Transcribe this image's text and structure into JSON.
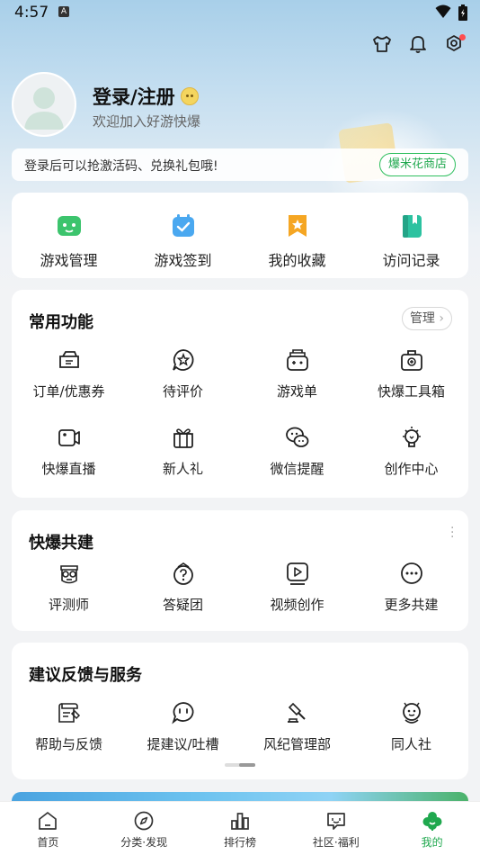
{
  "status_bar": {
    "time": "4:57",
    "notif_letter": "A"
  },
  "profile": {
    "title": "登录/注册",
    "subtitle": "欢迎加入好游快爆"
  },
  "notice": {
    "text": "登录后可以抢激活码、兑换礼包哦!",
    "button": "爆米花商店"
  },
  "quick": [
    {
      "label": "游戏管理",
      "color": "#3cc46d",
      "icon": "gamepad-icon"
    },
    {
      "label": "游戏签到",
      "color": "#4aa8f0",
      "icon": "calendar-check-icon"
    },
    {
      "label": "我的收藏",
      "color": "#f5a623",
      "icon": "bookmark-star-icon"
    },
    {
      "label": "访问记录",
      "color": "#2cc2a0",
      "icon": "book-icon"
    }
  ],
  "common": {
    "title": "常用功能",
    "manage": "管理",
    "items": [
      {
        "label": "订单/优惠券",
        "icon": "coupon-icon"
      },
      {
        "label": "待评价",
        "icon": "star-bubble-icon"
      },
      {
        "label": "游戏单",
        "icon": "game-list-icon"
      },
      {
        "label": "快爆工具箱",
        "icon": "toolbox-icon"
      },
      {
        "label": "快爆直播",
        "icon": "video-camera-icon"
      },
      {
        "label": "新人礼",
        "icon": "gift-icon"
      },
      {
        "label": "微信提醒",
        "icon": "wechat-icon"
      },
      {
        "label": "创作中心",
        "icon": "lightbulb-icon"
      }
    ]
  },
  "build": {
    "title": "快爆共建",
    "items": [
      {
        "label": "评测师",
        "icon": "reviewer-icon"
      },
      {
        "label": "答疑团",
        "icon": "question-icon"
      },
      {
        "label": "视频创作",
        "icon": "play-icon"
      },
      {
        "label": "更多共建",
        "icon": "more-icon"
      }
    ]
  },
  "service": {
    "title": "建议反馈与服务",
    "items": [
      {
        "label": "帮助与反馈",
        "icon": "help-doc-icon"
      },
      {
        "label": "提建议/吐槽",
        "icon": "chat-bubble-icon"
      },
      {
        "label": "风纪管理部",
        "icon": "gavel-icon"
      },
      {
        "label": "同人社",
        "icon": "fan-club-icon"
      }
    ]
  },
  "tabs": [
    {
      "label": "首页",
      "icon": "home-icon"
    },
    {
      "label": "分类·发现",
      "icon": "compass-icon"
    },
    {
      "label": "排行榜",
      "icon": "ranking-icon"
    },
    {
      "label": "社区·福利",
      "icon": "community-icon"
    },
    {
      "label": "我的",
      "icon": "mine-icon",
      "active": true
    }
  ],
  "colors": {
    "accent": "#1fa84e",
    "badge": "#ff4d4f"
  }
}
